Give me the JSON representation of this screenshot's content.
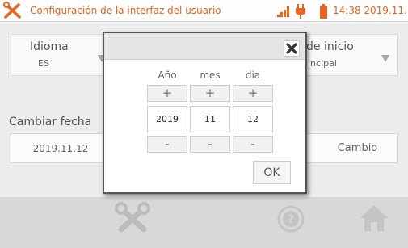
{
  "header": {
    "title": "Configuración de la interfaz del usuario",
    "time": "14:38 2019.11.12",
    "icons": [
      "tools-icon",
      "signal-icon",
      "plug-icon",
      "battery-icon"
    ],
    "accent_color": "#e8641e"
  },
  "background": {
    "language": {
      "label": "Idioma",
      "value": "ES"
    },
    "start_screen": {
      "label": "de inicio",
      "value": "incipal"
    },
    "change_date": {
      "label": "Cambiar fecha",
      "value": "2019.11.12",
      "button": "Cambio"
    }
  },
  "dialog": {
    "columns": [
      {
        "label": "Año",
        "value": "2019",
        "plus": "+",
        "minus": "-"
      },
      {
        "label": "mes",
        "value": "11",
        "plus": "+",
        "minus": "-"
      },
      {
        "label": "dia",
        "value": "12",
        "plus": "+",
        "minus": "-"
      }
    ],
    "ok_label": "OK"
  },
  "footer": {
    "icons": [
      "tools-icon",
      "help-icon",
      "home-icon"
    ]
  }
}
